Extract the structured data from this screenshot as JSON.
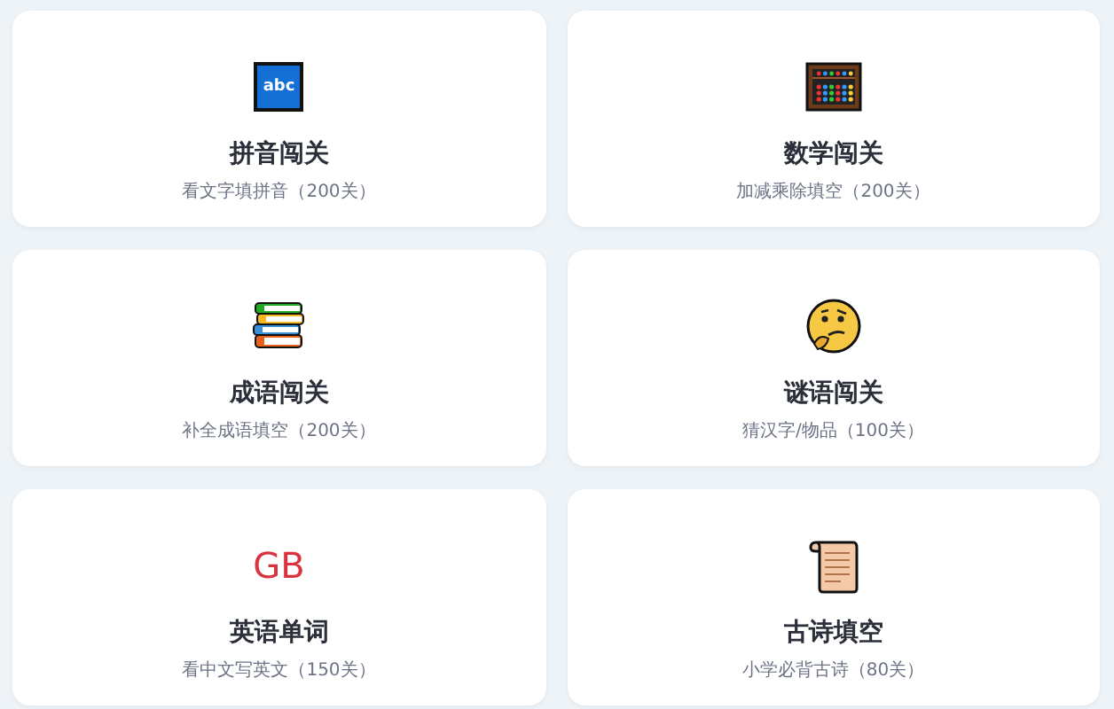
{
  "cards": [
    {
      "kind": "abc",
      "icon_text": "abc",
      "title": "拼音闯关",
      "subtitle": "看文字填拼音（200关）"
    },
    {
      "kind": "abacus",
      "title": "数学闯关",
      "subtitle": "加减乘除填空（200关）"
    },
    {
      "kind": "books",
      "title": "成语闯关",
      "subtitle": "补全成语填空（200关）"
    },
    {
      "kind": "thinking",
      "title": "谜语闯关",
      "subtitle": "猜汉字/物品（100关）"
    },
    {
      "kind": "letters",
      "icon_text": "GB",
      "title": "英语单词",
      "subtitle": "看中文写英文（150关）"
    },
    {
      "kind": "scroll",
      "title": "古诗填空",
      "subtitle": "小学必背古诗（80关）"
    }
  ]
}
